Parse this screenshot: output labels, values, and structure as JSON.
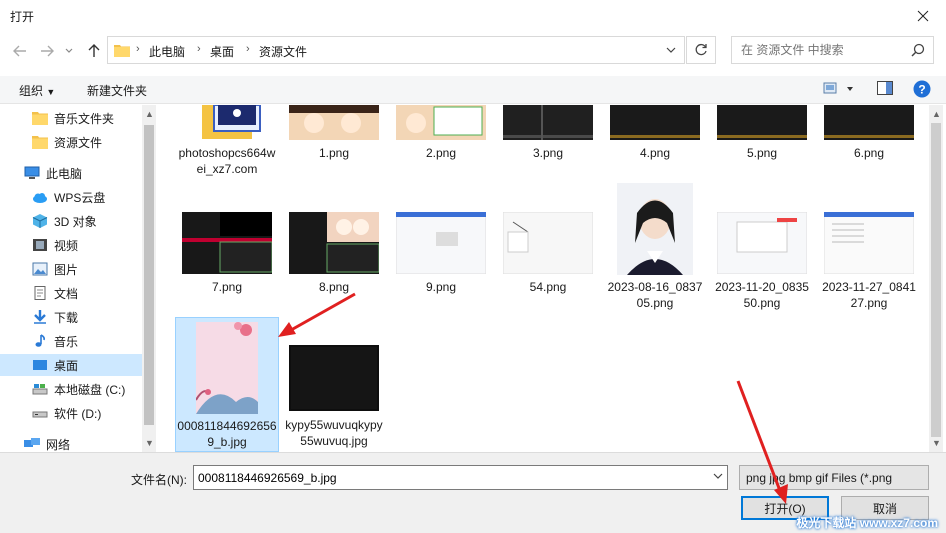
{
  "window": {
    "title": "打开"
  },
  "address": {
    "crumbs": [
      "此电脑",
      "桌面",
      "资源文件"
    ]
  },
  "search": {
    "placeholder": "在 资源文件 中搜索"
  },
  "toolbar": {
    "organize": "组织",
    "new_folder": "新建文件夹"
  },
  "nav": {
    "items": [
      {
        "label": "音乐文件夹",
        "icon": "folder-icon"
      },
      {
        "label": "资源文件",
        "icon": "folder-icon"
      },
      {
        "label": "此电脑",
        "icon": "computer-icon"
      },
      {
        "label": "WPS云盘",
        "icon": "cloud-icon"
      },
      {
        "label": "3D 对象",
        "icon": "cube-icon"
      },
      {
        "label": "视频",
        "icon": "video-icon"
      },
      {
        "label": "图片",
        "icon": "picture-icon"
      },
      {
        "label": "文档",
        "icon": "document-icon"
      },
      {
        "label": "下载",
        "icon": "download-icon"
      },
      {
        "label": "音乐",
        "icon": "music-icon"
      },
      {
        "label": "桌面",
        "icon": "desktop-icon",
        "selected": true
      },
      {
        "label": "本地磁盘 (C:)",
        "icon": "drive-icon"
      },
      {
        "label": "软件 (D:)",
        "icon": "drive-icon"
      },
      {
        "label": "网络",
        "icon": "network-icon"
      }
    ]
  },
  "files": {
    "row1": [
      "photoshopcs664wei_xz7.com",
      "1.png",
      "2.png",
      "3.png",
      "4.png",
      "5.png",
      "6.png"
    ],
    "row2": [
      "7.png",
      "8.png",
      "9.png",
      "54.png",
      "2023-08-16_083705.png",
      "2023-11-20_083550.png",
      "2023-11-27_084127.png"
    ],
    "row3": [
      "0008118446926569_b.jpg",
      "kypy55wuvuqkypy55wuvuq.jpg"
    ]
  },
  "bottom": {
    "filename_label": "文件名(N):",
    "filename_value": "0008118446926569_b.jpg",
    "filetype": "png jpg bmp gif Files (*.png",
    "open_label": "打开(O)",
    "cancel_label": "取消"
  },
  "watermark": "极光下载站 www.xz7.com",
  "colors": {
    "selection": "#cce8ff",
    "accent": "#0078d7",
    "arrow": "#e02020"
  }
}
